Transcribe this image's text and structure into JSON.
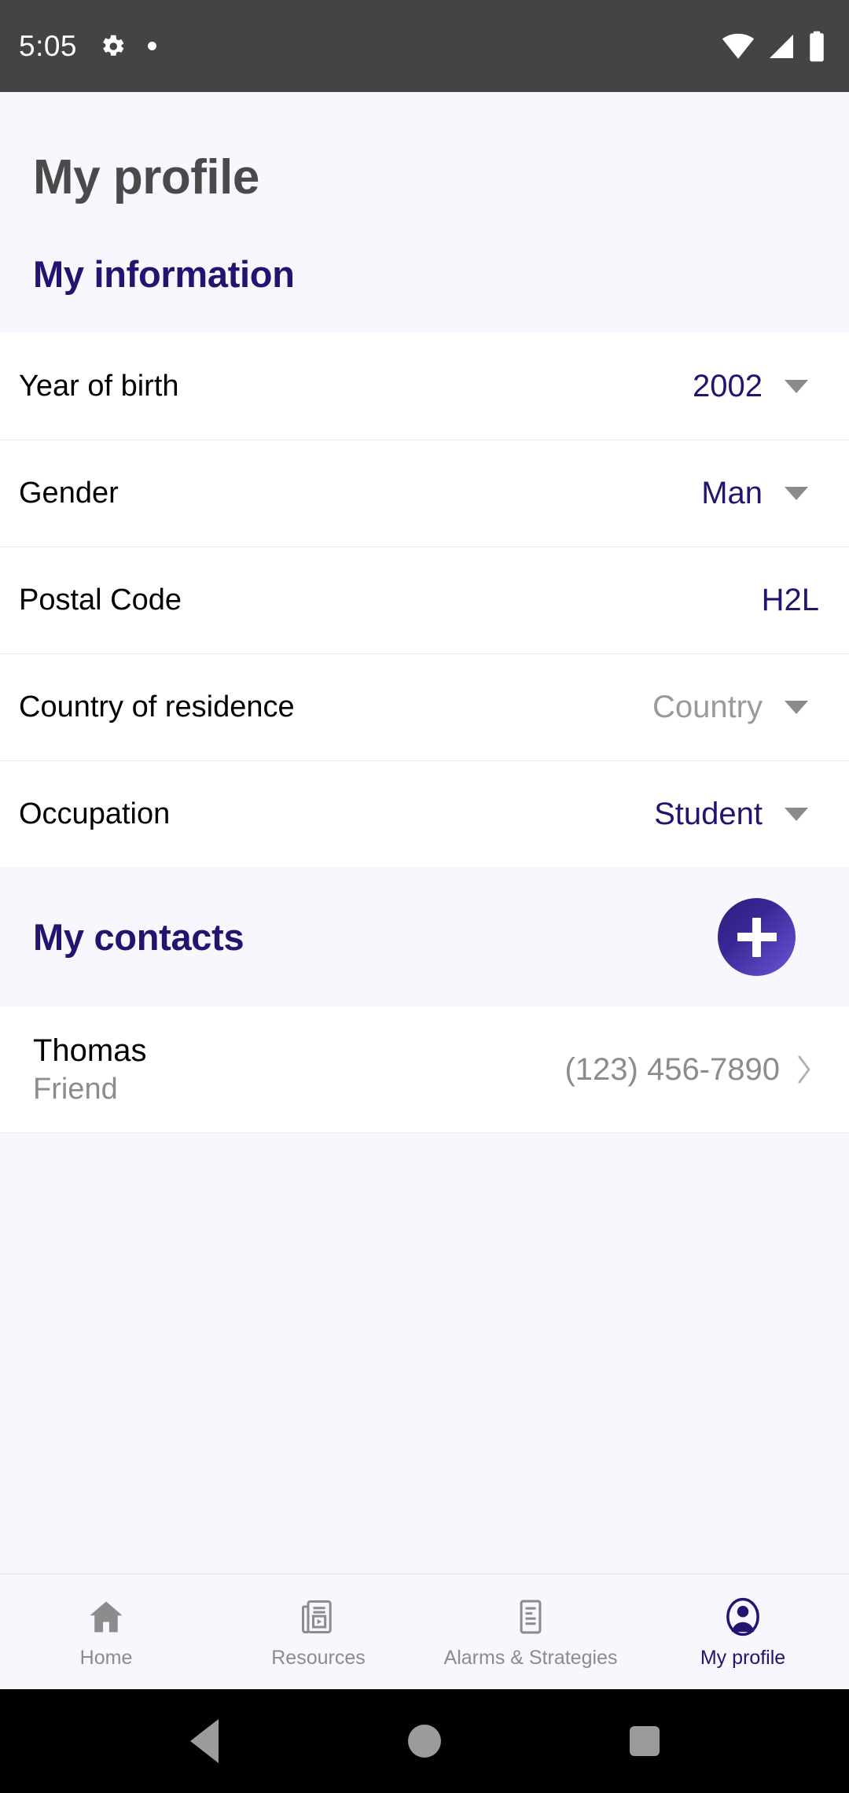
{
  "status_bar": {
    "time": "5:05",
    "icons_left": [
      "gear-icon",
      "dot-indicator-icon"
    ],
    "icons_right": [
      "wifi-icon",
      "cellular-signal-icon",
      "battery-icon"
    ]
  },
  "page": {
    "title": "My profile"
  },
  "information": {
    "heading": "My information",
    "rows": [
      {
        "label": "Year of birth",
        "value": "2002",
        "control": "dropdown",
        "is_placeholder": false
      },
      {
        "label": "Gender",
        "value": "Man",
        "control": "dropdown",
        "is_placeholder": false
      },
      {
        "label": "Postal Code",
        "value": "H2L",
        "control": "text",
        "is_placeholder": false
      },
      {
        "label": "Country of residence",
        "value": "Country",
        "control": "dropdown",
        "is_placeholder": true
      },
      {
        "label": "Occupation",
        "value": "Student",
        "control": "dropdown",
        "is_placeholder": false
      }
    ]
  },
  "contacts": {
    "heading": "My contacts",
    "add_label": "+",
    "items": [
      {
        "name": "Thomas",
        "relation": "Friend",
        "phone": "(123) 456-7890"
      }
    ]
  },
  "bottom_nav": {
    "items": [
      {
        "label": "Home",
        "icon": "home-icon",
        "active": false
      },
      {
        "label": "Resources",
        "icon": "newspaper-icon",
        "active": false
      },
      {
        "label": "Alarms & Strategies",
        "icon": "document-icon",
        "active": false
      },
      {
        "label": "My profile",
        "icon": "person-icon",
        "active": true
      }
    ]
  },
  "system_nav": {
    "buttons": [
      "back-button",
      "home-button",
      "recents-button"
    ]
  },
  "colors": {
    "brand_navy": "#24136f",
    "accent_purple": "#6a57d6",
    "background": "#f7f7fd",
    "card": "#ffffff",
    "muted_text": "#8c8c8c",
    "status_bar": "#444444"
  }
}
